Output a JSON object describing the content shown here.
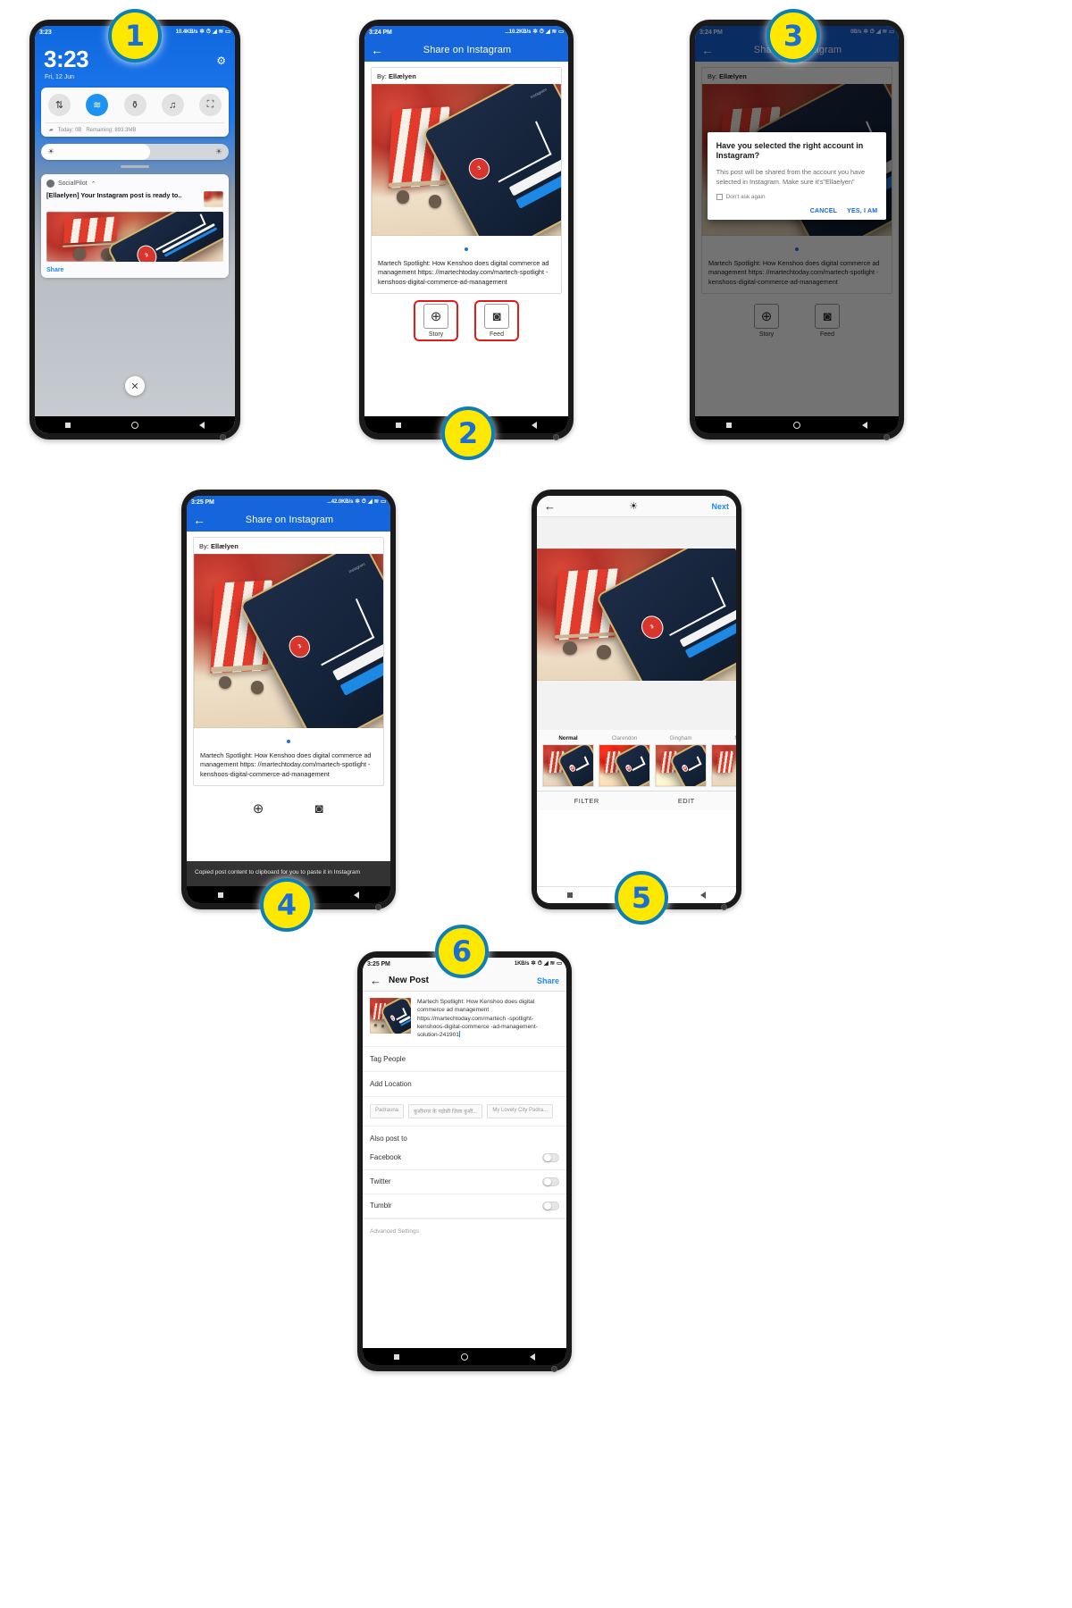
{
  "meta": {
    "flow_title": "Share on Instagram via SocialPilot — 6 step walkthrough"
  },
  "colors": {
    "appbar_blue": "#1565dc",
    "link_blue": "#1f8bf0",
    "badge_yellow": "#ffe800",
    "badge_ring": "#0d7fb8",
    "highlight_red": "#e01b18"
  },
  "shared": {
    "post_author_label": "By:",
    "post_author": "Ellælyen",
    "caption": "Martech Spotlight: How Kenshoo does digital commerce ad management https: //martechtoday.com/martech-spotlight -kenshoos-digital-commerce-ad-management",
    "appbar_title": "Share on Instagram",
    "back_icon": "arrow-left-icon",
    "story_label": "Story",
    "feed_label": "Feed",
    "story_icon": "plus-circle-icon",
    "feed_icon": "instagram-camera-icon"
  },
  "steps": [
    {
      "number": "1"
    },
    {
      "number": "2"
    },
    {
      "number": "3"
    },
    {
      "number": "4"
    },
    {
      "number": "5"
    },
    {
      "number": "6"
    }
  ],
  "phone1": {
    "status": {
      "time": "3:23",
      "right": "10.4KB/s"
    },
    "lock": {
      "clock": "3:23",
      "date": "Fri, 12 Jun",
      "settings_icon": "gear-icon"
    },
    "quick_settings": {
      "tiles": [
        {
          "name": "mobile-data-icon",
          "glyph": "⇅",
          "active": false
        },
        {
          "name": "wifi-icon",
          "glyph": "≋",
          "active": true
        },
        {
          "name": "flashlight-icon",
          "glyph": "⚲",
          "active": false
        },
        {
          "name": "bell-icon",
          "glyph": "🔔",
          "active": false
        },
        {
          "name": "screenshot-icon",
          "glyph": "⛶",
          "active": false
        }
      ],
      "data_today_label": "Today: 0B",
      "data_remaining_label": "Remaining: 893.3MB"
    },
    "brightness": {
      "low_icon": "brightness-low-icon",
      "high_icon": "brightness-high-icon"
    },
    "notification": {
      "app_name": "SocialPilot",
      "collapse_icon": "chevron-up-icon",
      "title": "[Ellaelyen] Your Instagram post is ready to..",
      "action": "Share"
    },
    "close_label": "✕",
    "navbar": [
      "recents-square-icon",
      "home-circle-icon",
      "back-triangle-icon"
    ]
  },
  "phone2": {
    "status": {
      "time": "3:24 PM",
      "right": "...10.2KB/s"
    },
    "page_dot": "carousel-dot",
    "highlight": "Story and Feed buttons outlined in red"
  },
  "phone3": {
    "status": {
      "time": "3:24 PM",
      "right": "0B/s"
    },
    "dialog": {
      "title": "Have you selected the right account in Instagram?",
      "body": "This post will be shared from the account you have selected in Instagram. Make sure it's\"Ellaelyen\"",
      "checkbox_label": "Don't ask again",
      "cancel": "CANCEL",
      "confirm": "YES, I AM"
    },
    "caption_visible": "digital commerce ad management https: //martechtoday.com/martech-spotlight -kenshoos-digital-commerce-ad-management"
  },
  "phone4": {
    "status": {
      "time": "3:25 PM",
      "right": "...42.0KB/s"
    },
    "toast": "Copied post content to clipboard for you to paste it in Instagram"
  },
  "phone5": {
    "topbar": {
      "back_icon": "arrow-left-icon",
      "sun_icon": "brightness-sun-icon",
      "next": "Next"
    },
    "filters": [
      {
        "name": "Normal",
        "active": true
      },
      {
        "name": "Clarendon",
        "active": false
      },
      {
        "name": "Gingham",
        "active": false
      },
      {
        "name": "M",
        "active": false
      }
    ],
    "tabs": [
      {
        "label": "FILTER",
        "active": true
      },
      {
        "label": "EDIT",
        "active": false
      }
    ]
  },
  "phone6": {
    "status": {
      "time": "3:25 PM",
      "right": "1KB/s"
    },
    "topbar": {
      "back_icon": "arrow-left-icon",
      "title": "New Post",
      "share": "Share"
    },
    "compose_text": "Martech Spotlight: How Kenshoo does digital commerce ad management https://martechtoday.com/martech -spotlight-kenshoos-digital-commerce -ad-management-solution-241901",
    "rows": [
      {
        "label": "Tag People"
      },
      {
        "label": "Add Location"
      }
    ],
    "location_chips": [
      "Padrauna",
      "कुशीनगर के पड़ोसी जिला कुशी...",
      "My Lovely City Padra..."
    ],
    "also_post_to_label": "Also post to",
    "toggles": [
      {
        "label": "Facebook",
        "on": false
      },
      {
        "label": "Twitter",
        "on": false
      },
      {
        "label": "Tumblr",
        "on": false
      }
    ],
    "advanced_settings_label": "Advanced Settings"
  }
}
